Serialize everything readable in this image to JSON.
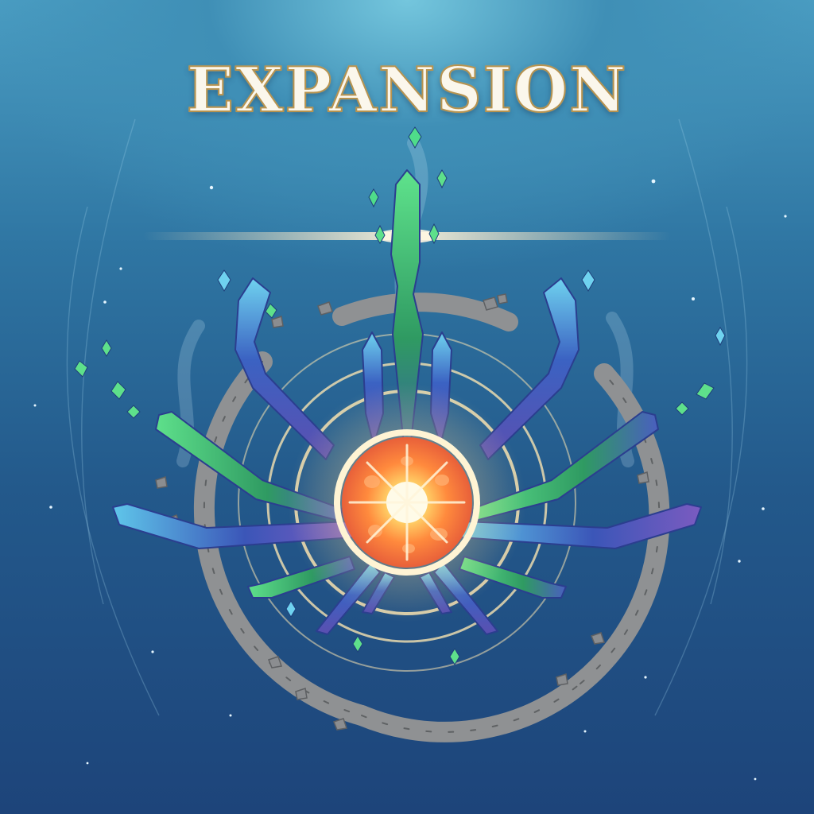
{
  "title": "EXPANSION",
  "palette": {
    "sky_top": "#74c6dd",
    "sky_bottom": "#1d447a",
    "core_glow": "#ff8a3d",
    "core_center": "#fff3b0",
    "crystal_blue": "#3d5bb8",
    "crystal_cyan": "#63c6e6",
    "crystal_green": "#3fbf6a",
    "stone": "#8e9092",
    "ring_gold": "#f6e2b0"
  },
  "icons": {
    "core": "glowing-orb",
    "crystals": "crystal-shard",
    "ring": "broken-stone-ring",
    "sparkles": "star"
  }
}
